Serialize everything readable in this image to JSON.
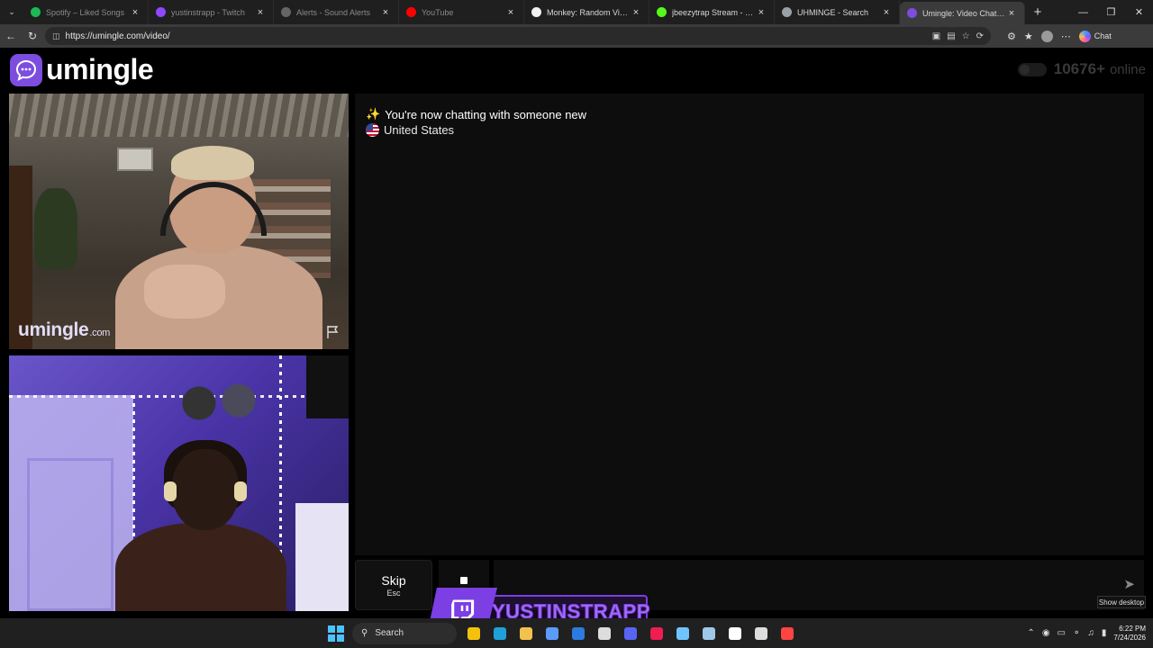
{
  "browser": {
    "tabs": [
      {
        "title": "Spotify – Liked Songs",
        "color": "#1db954",
        "dim": true
      },
      {
        "title": "yustinstrapp - Twitch",
        "color": "#9146ff",
        "dim": true
      },
      {
        "title": "Alerts - Sound Alerts",
        "color": "#666666",
        "dim": true
      },
      {
        "title": "YouTube",
        "color": "#ff0000",
        "dim": true
      },
      {
        "title": "Monkey: Random Video",
        "color": "#f2f2f2",
        "dim": false
      },
      {
        "title": "jbeezytrap Stream - Watch Live",
        "color": "#53fc18",
        "dim": false
      },
      {
        "title": "UHMINGE - Search",
        "color": "#9aa0a6",
        "dim": false
      },
      {
        "title": "Umingle: Video Chat with Strangers",
        "color": "#7c4ddf",
        "dim": false,
        "active": true
      }
    ],
    "new_tab": "+",
    "url": "https://umingle.com/video/",
    "chat_label": "Chat"
  },
  "site": {
    "logo_text": "umingle",
    "online_count": "10676+",
    "online_label": "online"
  },
  "video": {
    "watermark": "umingle",
    "watermark_suffix": ".com"
  },
  "chat": {
    "message_1": "You're now chatting with someone new",
    "message_2": "United States",
    "skip_label": "Skip",
    "skip_key": "Esc"
  },
  "overlay": {
    "twitch_name": "YUSTINSTRAPP"
  },
  "tooltip": {
    "show_desktop": "Show desktop"
  },
  "taskbar": {
    "search_placeholder": "Search",
    "apps": [
      {
        "icon": "chrome-icon",
        "color": "#f4c20d"
      },
      {
        "icon": "edge-icon",
        "color": "#1fa0d8"
      },
      {
        "icon": "file-explorer-icon",
        "color": "#f2c14e"
      },
      {
        "icon": "app-icon",
        "color": "#5a9cf8"
      },
      {
        "icon": "outlook-icon",
        "color": "#2d7be0"
      },
      {
        "icon": "calendar-icon",
        "color": "#dddddd"
      },
      {
        "icon": "discord-icon",
        "color": "#5865f2"
      },
      {
        "icon": "tiktok-icon",
        "color": "#ee1d52"
      },
      {
        "icon": "notepad-icon",
        "color": "#6fc3ff"
      },
      {
        "icon": "steam-icon",
        "color": "#9fc7e8"
      },
      {
        "icon": "audio-icon",
        "color": "#ffffff"
      },
      {
        "icon": "obs-icon",
        "color": "#dddddd"
      },
      {
        "icon": "app-icon-2",
        "color": "#ff4444"
      }
    ],
    "time": "6:22 PM",
    "date": "7/24/2026"
  }
}
